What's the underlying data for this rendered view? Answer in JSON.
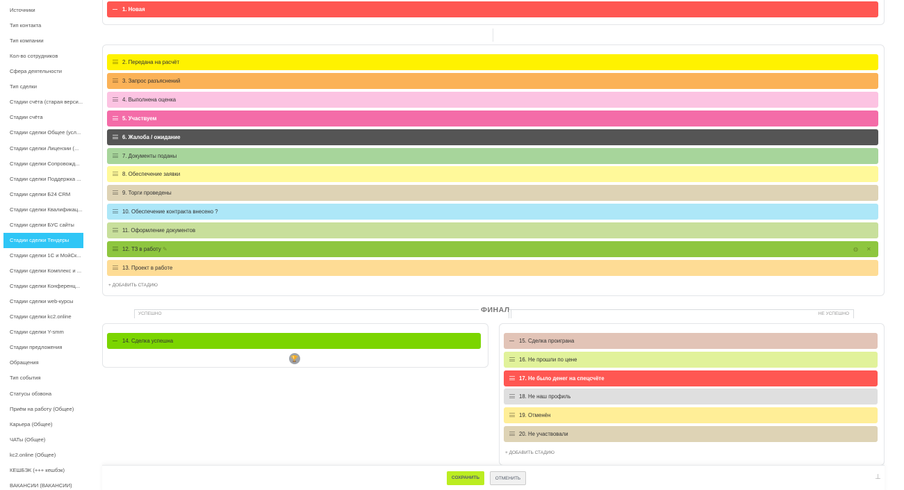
{
  "sidebar": {
    "items": [
      {
        "label": "Источники"
      },
      {
        "label": "Тип контакта"
      },
      {
        "label": "Тип компании"
      },
      {
        "label": "Кол-во сотрудников"
      },
      {
        "label": "Сфера деятельности"
      },
      {
        "label": "Тип сделки"
      },
      {
        "label": "Стадии счёта (старая верси..."
      },
      {
        "label": "Стадии счёта"
      },
      {
        "label": "Стадии сделки Общее (усл..."
      },
      {
        "label": "Стадии сделки Лицензии (..."
      },
      {
        "label": "Стадии сделки Сопровожд..."
      },
      {
        "label": "Стадии сделки Поддержка ..."
      },
      {
        "label": "Стадии сделки Б24 CRM"
      },
      {
        "label": "Стадии сделки Квалификац..."
      },
      {
        "label": "Стадии сделки БУС сайты"
      },
      {
        "label": "Стадии сделки Тендеры"
      },
      {
        "label": "Стадии сделки 1С и МойСк..."
      },
      {
        "label": "Стадии сделки Комплекс и ..."
      },
      {
        "label": "Стадии сделки Конференц..."
      },
      {
        "label": "Стадии сделки web-курсы"
      },
      {
        "label": "Стадии сделки kc2.online"
      },
      {
        "label": "Стадии сделки Y-smm"
      },
      {
        "label": "Стадии предложения"
      },
      {
        "label": "Обращения"
      },
      {
        "label": "Тип события"
      },
      {
        "label": "Статусы обзвона"
      },
      {
        "label": "Приём на работу (Общее)"
      },
      {
        "label": "Карьера (Общее)"
      },
      {
        "label": "ЧАТы (Общее)"
      },
      {
        "label": "kc2.online (Общее)"
      },
      {
        "label": "КЕШБЭК (+++ кешбэк)"
      },
      {
        "label": "ВАКАНСИИ (ВАКАНСИИ)"
      }
    ],
    "active_index": 15
  },
  "first_stage": {
    "label": "1. Новая",
    "color": "#ff5752"
  },
  "process_stages": [
    {
      "label": "2. Передана на расчёт",
      "color": "#fff200"
    },
    {
      "label": "3. Запрос разъяснений",
      "color": "#fbb257"
    },
    {
      "label": "4. Выполнена оценка",
      "color": "#fcc3e2"
    },
    {
      "label": "5. Участвуем",
      "color": "#f46ca8"
    },
    {
      "label": "6. Жалоба / ожидание",
      "color": "#555555"
    },
    {
      "label": "7. Документы поданы",
      "color": "#a7d59b"
    },
    {
      "label": "8. Обеспечение заявки",
      "color": "#fff99a"
    },
    {
      "label": "9. Торги проведены",
      "color": "#ded3b5"
    },
    {
      "label": "10. Обеспечение контракта внесено ?",
      "color": "#ade7f8"
    },
    {
      "label": "11. Оформление документов",
      "color": "#c8df9b"
    },
    {
      "label": "12. ТЗ в работу",
      "color": "#8ec63f"
    },
    {
      "label": "13. Проект в работе",
      "color": "#fedc95"
    }
  ],
  "add_stage_label": "+ ДОБАВИТЬ СТАДИЮ",
  "final": {
    "title": "ФИНАЛ",
    "success_tab": "УСПЕШНО",
    "fail_tab": "НЕ УСПЕШНО",
    "success_stage": {
      "label": "14. Сделка успешна",
      "color": "#7bd500"
    },
    "fail_stages": [
      {
        "label": "15. Сделка проиграна",
        "color": "#e2c4b7"
      },
      {
        "label": "16. Не прошли по цене",
        "color": "#e1f29a"
      },
      {
        "label": "17. Не было денег на спецсчёте",
        "color": "#ff5752"
      },
      {
        "label": "18. Не наш профиль",
        "color": "#dfdfdf"
      },
      {
        "label": "19. Отменён",
        "color": "#ffee97"
      },
      {
        "label": "20. Не участвовали",
        "color": "#ded3b5"
      }
    ],
    "fail_add_label": "+ ДОБАВИТЬ СТАДИЮ"
  },
  "footer": {
    "save_label": "СОХРАНИТЬ",
    "cancel_label": "ОТМЕНИТЬ"
  },
  "icons": {
    "trophy": "trophy-icon",
    "pencil": "pencil-icon",
    "pin": "pin-icon"
  }
}
